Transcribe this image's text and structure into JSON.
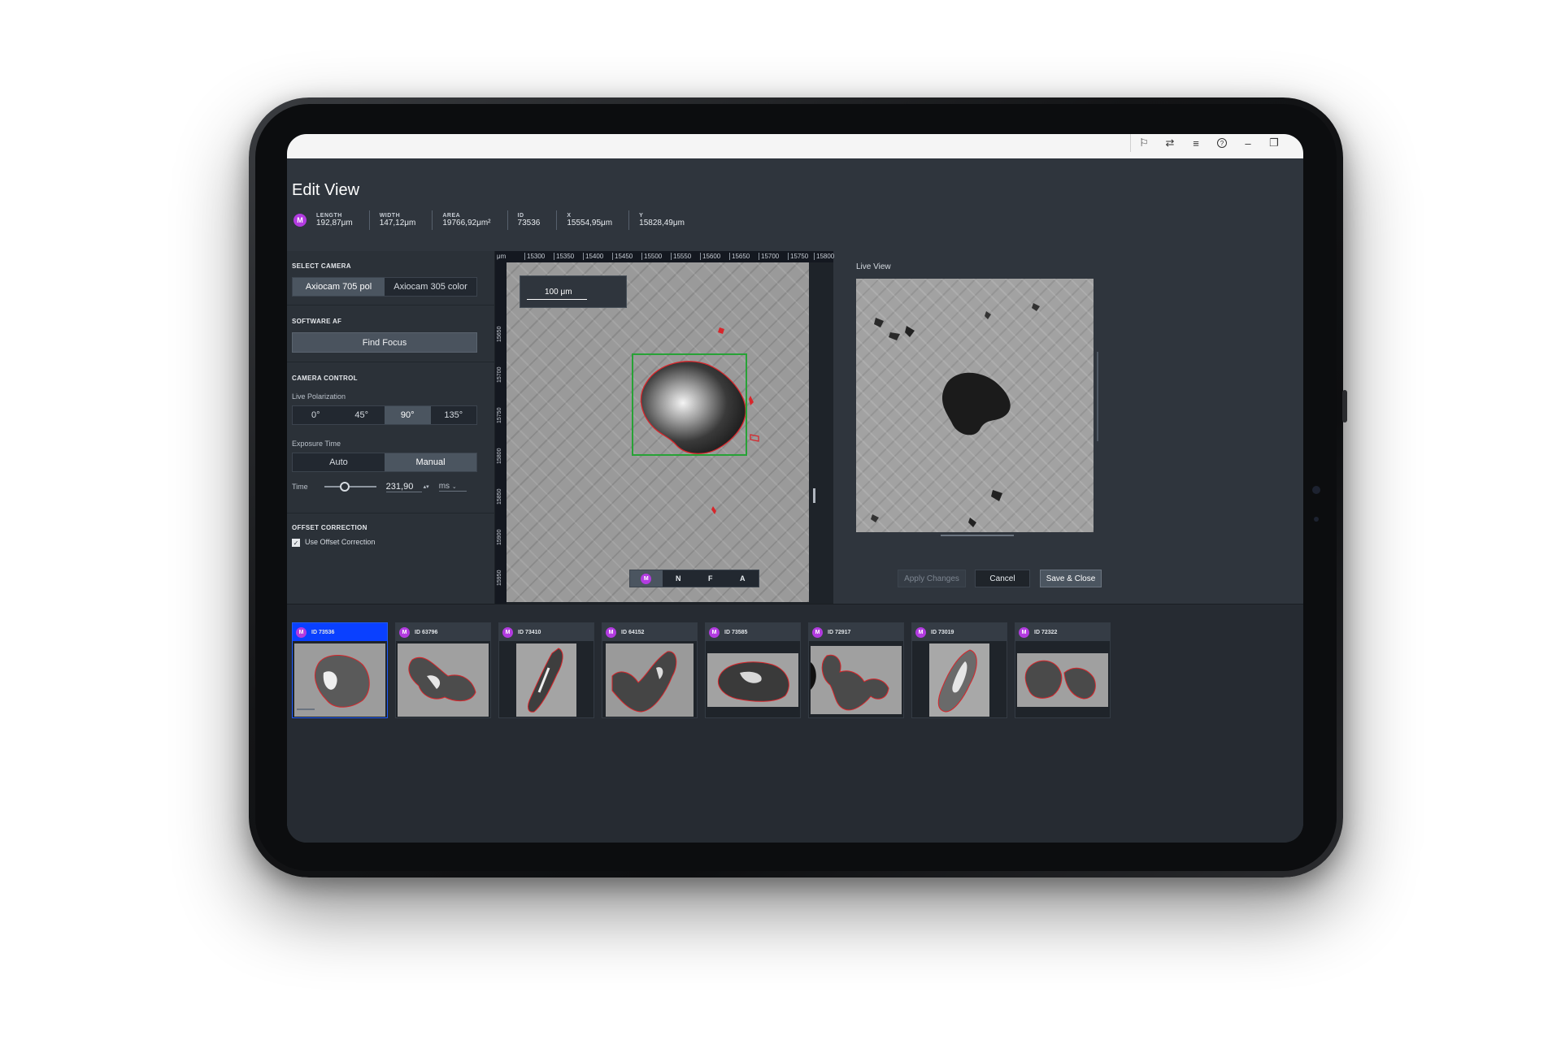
{
  "window": {
    "icons": [
      "flag-icon",
      "settings-sliders-icon",
      "menu-icon",
      "help-icon",
      "minimize-icon",
      "restore-icon"
    ],
    "icon_glyphs": [
      "⚐",
      "⇄",
      "≡",
      "?",
      "–",
      "❐"
    ]
  },
  "page": {
    "title": "Edit View",
    "badge": "M",
    "meta": [
      {
        "label": "LENGTH",
        "value": "192,87μm"
      },
      {
        "label": "WIDTH",
        "value": "147,12μm"
      },
      {
        "label": "AREA",
        "value": "19766,92μm²"
      },
      {
        "label": "ID",
        "value": "73536"
      },
      {
        "label": "X",
        "value": "15554,95μm"
      },
      {
        "label": "Y",
        "value": "15828,49μm"
      }
    ]
  },
  "panel": {
    "select_camera": {
      "header": "SELECT CAMERA",
      "options": [
        "Axiocam 705 pol",
        "Axiocam 305 color"
      ],
      "selected": "Axiocam 705 pol"
    },
    "software_af": {
      "header": "SOFTWARE AF",
      "button": "Find Focus"
    },
    "camera_control": {
      "header": "CAMERA CONTROL",
      "live_polarization_label": "Live Polarization",
      "polarization_options": [
        "0°",
        "45°",
        "90°",
        "135°"
      ],
      "polarization_selected": "90°",
      "exposure_label": "Exposure Time",
      "exposure_modes": [
        "Auto",
        "Manual"
      ],
      "exposure_selected": "Manual",
      "time_label": "Time",
      "time_value": "231,90",
      "time_unit": "ms",
      "time_slider_fraction": 0.4
    },
    "offset_correction": {
      "header": "OFFSET CORRECTION",
      "checkbox_label": "Use Offset Correction",
      "checked": true
    }
  },
  "viewer": {
    "ruler_unit": "μm",
    "x_ticks": [
      "15300",
      "15350",
      "15400",
      "15450",
      "15500",
      "15550",
      "15600",
      "15650",
      "15700",
      "15750",
      "15800"
    ],
    "y_ticks": [
      "15650",
      "15700",
      "15750",
      "15800",
      "15850",
      "15900",
      "15950",
      "16000"
    ],
    "scale_bar_label": "100 μm"
  },
  "live_view": {
    "label": "Live View"
  },
  "actions": {
    "mode_tabs": [
      "M",
      "N",
      "F",
      "A"
    ],
    "mode_selected": "M",
    "apply": "Apply Changes",
    "cancel": "Cancel",
    "save_close": "Save & Close"
  },
  "thumbnails": [
    {
      "badge": "M",
      "id": "ID 73536",
      "selected": true
    },
    {
      "badge": "M",
      "id": "ID 63796",
      "selected": false
    },
    {
      "badge": "M",
      "id": "ID 73410",
      "selected": false
    },
    {
      "badge": "M",
      "id": "ID 64152",
      "selected": false
    },
    {
      "badge": "M",
      "id": "ID 73585",
      "selected": false
    },
    {
      "badge": "M",
      "id": "ID 72917",
      "selected": false
    },
    {
      "badge": "M",
      "id": "ID 73019",
      "selected": false
    },
    {
      "badge": "M",
      "id": "ID 72322",
      "selected": false
    }
  ],
  "colors": {
    "badge": "#b23be0",
    "selection_blue": "#0a40ff",
    "bbox_green": "#27a236",
    "contour_red": "#d8262b"
  }
}
